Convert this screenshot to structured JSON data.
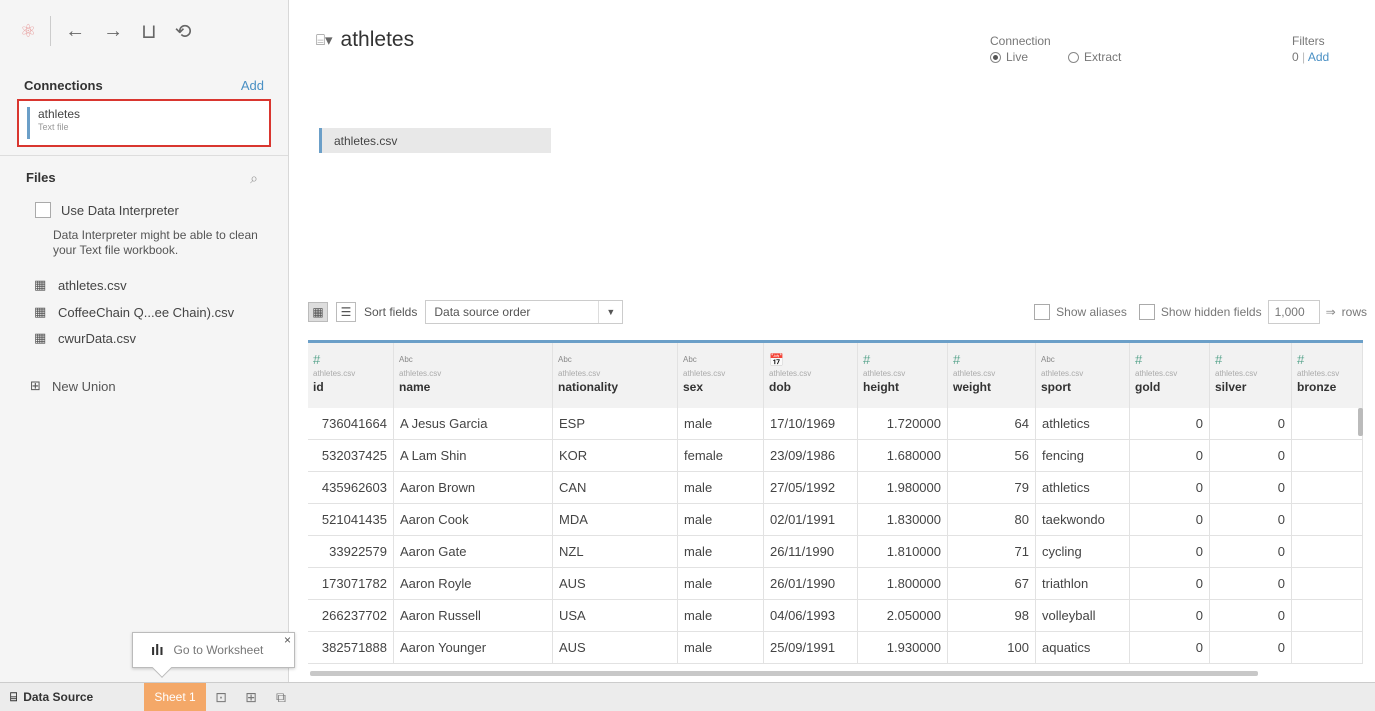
{
  "toolbar": {
    "logo": "⚛",
    "back": "←",
    "forward": "→",
    "save": "⊔",
    "refresh": "⟲"
  },
  "connections": {
    "heading": "Connections",
    "add_label": "Add",
    "items": [
      {
        "name": "athletes",
        "subtitle": "Text file"
      }
    ]
  },
  "files": {
    "heading": "Files",
    "search_icon": "⌕",
    "interpreter_label": "Use Data Interpreter",
    "interpreter_note": "Data Interpreter might be able to clean your Text file workbook.",
    "items": [
      {
        "icon": "table-icon",
        "name": "athletes.csv"
      },
      {
        "icon": "table-icon",
        "name": "CoffeeChain Q...ee Chain).csv"
      },
      {
        "icon": "table-icon",
        "name": "cwurData.csv"
      }
    ],
    "new_union": "New Union"
  },
  "tooltip": {
    "text": "Go to Worksheet",
    "close": "×"
  },
  "bottom_tabs": {
    "data_source": "Data Source",
    "sheet": "Sheet 1"
  },
  "main": {
    "title": "athletes",
    "connection_label": "Connection",
    "live_label": "Live",
    "extract_label": "Extract",
    "connection_selected": "Live",
    "filters_label": "Filters",
    "filters_count": "0",
    "filters_add": "Add",
    "canvas_table": "athletes.csv"
  },
  "grid_toolbar": {
    "sort_label": "Sort fields",
    "sort_value": "Data source order",
    "show_aliases": "Show aliases",
    "show_hidden": "Show hidden fields",
    "rows_value": "1,000",
    "rows_label": "rows"
  },
  "table": {
    "columns": [
      {
        "type": "#",
        "source": "athletes.csv",
        "name": "id"
      },
      {
        "type": "Abc",
        "source": "athletes.csv",
        "name": "name"
      },
      {
        "type": "Abc",
        "source": "athletes.csv",
        "name": "nationality"
      },
      {
        "type": "Abc",
        "source": "athletes.csv",
        "name": "sex"
      },
      {
        "type": "date",
        "source": "athletes.csv",
        "name": "dob"
      },
      {
        "type": "#",
        "source": "athletes.csv",
        "name": "height"
      },
      {
        "type": "#",
        "source": "athletes.csv",
        "name": "weight"
      },
      {
        "type": "Abc",
        "source": "athletes.csv",
        "name": "sport"
      },
      {
        "type": "#",
        "source": "athletes.csv",
        "name": "gold"
      },
      {
        "type": "#",
        "source": "athletes.csv",
        "name": "silver"
      },
      {
        "type": "#",
        "source": "athletes.csv",
        "name": "bronze"
      }
    ],
    "rows": [
      [
        "736041664",
        "A Jesus Garcia",
        "ESP",
        "male",
        "17/10/1969",
        "1.720000",
        "64",
        "athletics",
        "0",
        "0",
        ""
      ],
      [
        "532037425",
        "A Lam Shin",
        "KOR",
        "female",
        "23/09/1986",
        "1.680000",
        "56",
        "fencing",
        "0",
        "0",
        ""
      ],
      [
        "435962603",
        "Aaron Brown",
        "CAN",
        "male",
        "27/05/1992",
        "1.980000",
        "79",
        "athletics",
        "0",
        "0",
        ""
      ],
      [
        "521041435",
        "Aaron Cook",
        "MDA",
        "male",
        "02/01/1991",
        "1.830000",
        "80",
        "taekwondo",
        "0",
        "0",
        ""
      ],
      [
        "33922579",
        "Aaron Gate",
        "NZL",
        "male",
        "26/11/1990",
        "1.810000",
        "71",
        "cycling",
        "0",
        "0",
        ""
      ],
      [
        "173071782",
        "Aaron Royle",
        "AUS",
        "male",
        "26/01/1990",
        "1.800000",
        "67",
        "triathlon",
        "0",
        "0",
        ""
      ],
      [
        "266237702",
        "Aaron Russell",
        "USA",
        "male",
        "04/06/1993",
        "2.050000",
        "98",
        "volleyball",
        "0",
        "0",
        ""
      ],
      [
        "382571888",
        "Aaron Younger",
        "AUS",
        "male",
        "25/09/1991",
        "1.930000",
        "100",
        "aquatics",
        "0",
        "0",
        ""
      ]
    ]
  }
}
